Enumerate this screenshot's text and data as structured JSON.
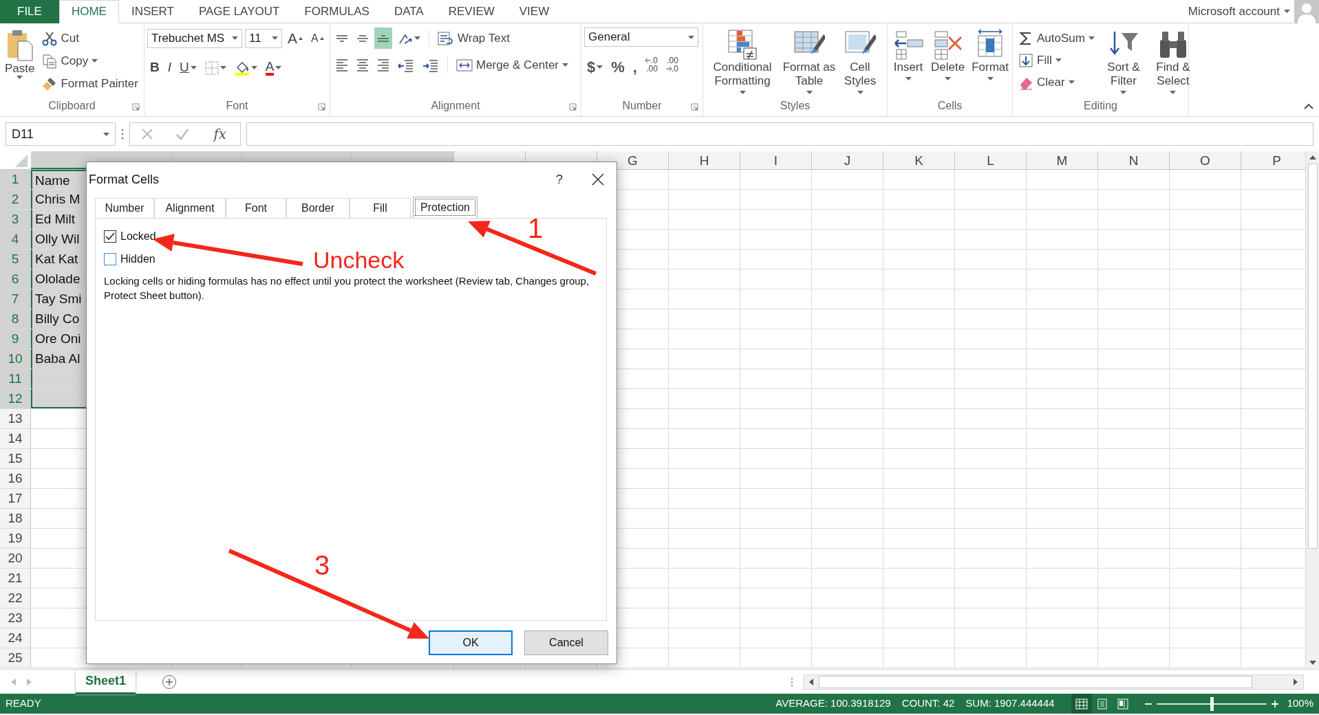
{
  "ribbon_tabs": [
    {
      "label": "FILE",
      "kind": "file",
      "selected": false
    },
    {
      "label": "HOME",
      "kind": "tab",
      "selected": true
    },
    {
      "label": "INSERT",
      "kind": "tab",
      "selected": false
    },
    {
      "label": "PAGE LAYOUT",
      "kind": "tab",
      "selected": false
    },
    {
      "label": "FORMULAS",
      "kind": "tab",
      "selected": false
    },
    {
      "label": "DATA",
      "kind": "tab",
      "selected": false
    },
    {
      "label": "REVIEW",
      "kind": "tab",
      "selected": false
    },
    {
      "label": "VIEW",
      "kind": "tab",
      "selected": false
    }
  ],
  "account": {
    "label": "Microsoft account"
  },
  "ribbon_groups": [
    {
      "kind": "clipboard",
      "name": "Clipboard",
      "launcher": true,
      "items": [
        {
          "label": "Paste",
          "kind": "paste",
          "dropdown": true
        },
        {
          "label": "Cut",
          "kind": "cut",
          "dropdown": false
        },
        {
          "label": "Copy",
          "kind": "copy",
          "dropdown": true
        },
        {
          "label": "Format Painter",
          "kind": "painter",
          "dropdown": false
        }
      ]
    },
    {
      "kind": "font",
      "name": "Font",
      "launcher": true,
      "font_name": "Trebuchet MS",
      "font_size": "11",
      "size_buttons": [
        {
          "label": "A",
          "kind": "grow"
        },
        {
          "label": "A",
          "kind": "shrink"
        }
      ],
      "style_buttons": [
        {
          "label": "B",
          "kind": "bold",
          "dropdown": false
        },
        {
          "label": "I",
          "kind": "italic",
          "dropdown": false
        },
        {
          "label": "U",
          "kind": "underline",
          "dropdown": true
        }
      ],
      "font_color": {
        "label": "A",
        "color": "#ff0000"
      }
    },
    {
      "kind": "alignment",
      "name": "Alignment",
      "launcher": true,
      "align_buttons": [
        {
          "kind": "top",
          "selected": false
        },
        {
          "kind": "middle",
          "selected": false
        },
        {
          "kind": "bottom",
          "selected": true
        }
      ],
      "items": [
        {
          "label": "Wrap Text",
          "kind": "wrap",
          "dropdown": false
        },
        {
          "label": "Merge & Center",
          "kind": "merge",
          "dropdown": true
        }
      ]
    },
    {
      "kind": "number",
      "name": "Number",
      "launcher": true,
      "format": "General",
      "buttons": [
        {
          "label": "$",
          "dropdown": true
        },
        {
          "label": "%",
          "dropdown": false
        },
        {
          "label": ",",
          "dropdown": false
        }
      ],
      "decimal_buttons": [
        {
          "kind": "increase",
          "top": ".0",
          "bottom": ".00"
        },
        {
          "kind": "decrease",
          "top": ".00",
          "bottom": ".0"
        }
      ]
    },
    {
      "kind": "styles",
      "name": "Styles",
      "launcher": false,
      "items": [
        {
          "label": "Conditional Formatting",
          "kind": "conditional",
          "dropdown": true
        },
        {
          "label": "Format as Table",
          "kind": "table",
          "dropdown": true
        },
        {
          "label": "Cell Styles",
          "kind": "cellstyles",
          "dropdown": true
        }
      ]
    },
    {
      "kind": "cells",
      "name": "Cells",
      "launcher": false,
      "items": [
        {
          "label": "Insert",
          "kind": "insert",
          "dropdown": true
        },
        {
          "label": "Delete",
          "kind": "delete",
          "dropdown": true
        },
        {
          "label": "Format",
          "kind": "format",
          "dropdown": true
        }
      ]
    },
    {
      "kind": "editing",
      "name": "Editing",
      "launcher": false,
      "items": [
        {
          "label": "AutoSum",
          "kind": "autosum",
          "dropdown": true
        },
        {
          "label": "Fill",
          "kind": "fill",
          "dropdown": true
        },
        {
          "label": "Clear",
          "kind": "clear",
          "dropdown": true
        },
        {
          "label": "Sort & Filter",
          "kind": "sort",
          "dropdown": true
        },
        {
          "label": "Find & Select",
          "kind": "find",
          "dropdown": true
        }
      ]
    }
  ],
  "formula_bar": {
    "name_box": "D11",
    "function_label": "fx"
  },
  "columns": [
    {
      "selected": true
    },
    {
      "selected": true
    },
    {
      "selected": true
    },
    {
      "selected": true
    },
    {
      "selected": false
    },
    {
      "selected": false
    },
    {
      "label": "G",
      "selected": false
    },
    {
      "label": "H",
      "selected": false
    },
    {
      "label": "I",
      "selected": false
    },
    {
      "label": "J",
      "selected": false
    },
    {
      "label": "K",
      "selected": false
    },
    {
      "label": "L",
      "selected": false
    },
    {
      "label": "M",
      "selected": false
    },
    {
      "label": "N",
      "selected": false
    },
    {
      "label": "O",
      "selected": false
    },
    {
      "label": "P",
      "selected": false
    }
  ],
  "rows": [
    {
      "number": "1",
      "selected": true,
      "cell_a": "Name"
    },
    {
      "number": "2",
      "selected": true,
      "cell_a": "Chris M"
    },
    {
      "number": "3",
      "selected": true,
      "cell_a": "Ed Milt"
    },
    {
      "number": "4",
      "selected": true,
      "cell_a": "Olly Wil"
    },
    {
      "number": "5",
      "selected": true,
      "cell_a": "Kat Kat"
    },
    {
      "number": "6",
      "selected": true,
      "cell_a": "Ololade"
    },
    {
      "number": "7",
      "selected": true,
      "cell_a": "Tay Smi"
    },
    {
      "number": "8",
      "selected": true,
      "cell_a": "Billy Co"
    },
    {
      "number": "9",
      "selected": true,
      "cell_a": "Ore Oni"
    },
    {
      "number": "10",
      "selected": true,
      "cell_a": "Baba Al"
    },
    {
      "number": "11",
      "selected": true
    },
    {
      "number": "12",
      "selected": true
    },
    {
      "number": "13",
      "selected": false
    },
    {
      "number": "14",
      "selected": false
    },
    {
      "number": "15",
      "selected": false
    },
    {
      "number": "16",
      "selected": false
    },
    {
      "number": "17",
      "selected": false
    },
    {
      "number": "18",
      "selected": false
    },
    {
      "number": "19",
      "selected": false
    },
    {
      "number": "20",
      "selected": false
    },
    {
      "number": "21",
      "selected": false
    },
    {
      "number": "22",
      "selected": false
    },
    {
      "number": "23",
      "selected": false
    },
    {
      "number": "24",
      "selected": false
    },
    {
      "number": "25",
      "selected": false
    }
  ],
  "sheet_tabs": [
    {
      "label": "Sheet1",
      "selected": true
    }
  ],
  "status_bar": {
    "mode": "READY",
    "stats": [
      "AVERAGE: 100.3918129",
      "COUNT: 42",
      "SUM: 1907.444444"
    ],
    "views": [
      {
        "kind": "normal",
        "selected": true
      },
      {
        "kind": "page_layout",
        "selected": false
      },
      {
        "kind": "page_break",
        "selected": false
      }
    ],
    "zoom": {
      "level": 0.5,
      "reading": "100%"
    }
  },
  "dialog": {
    "title": "Format Cells",
    "help": "?",
    "tabs": [
      {
        "label": "Number",
        "selected": false
      },
      {
        "label": "Alignment",
        "selected": false
      },
      {
        "label": "Font",
        "selected": false
      },
      {
        "label": "Border",
        "selected": false
      },
      {
        "label": "Fill",
        "selected": false
      },
      {
        "label": "Protection",
        "selected": true
      }
    ],
    "options": [
      {
        "label": "Locked",
        "checked": true
      },
      {
        "label": "Hidden",
        "checked": false
      }
    ],
    "note": "Locking cells or hiding formulas has no effect until you protect the worksheet (Review tab, Changes group, Protect Sheet button).",
    "buttons": [
      {
        "label": "OK",
        "kind": "primary"
      },
      {
        "label": "Cancel",
        "kind": "secondary"
      }
    ]
  },
  "annotations": [
    {
      "text": "1"
    },
    {
      "text": "Uncheck"
    },
    {
      "text": "3"
    }
  ]
}
